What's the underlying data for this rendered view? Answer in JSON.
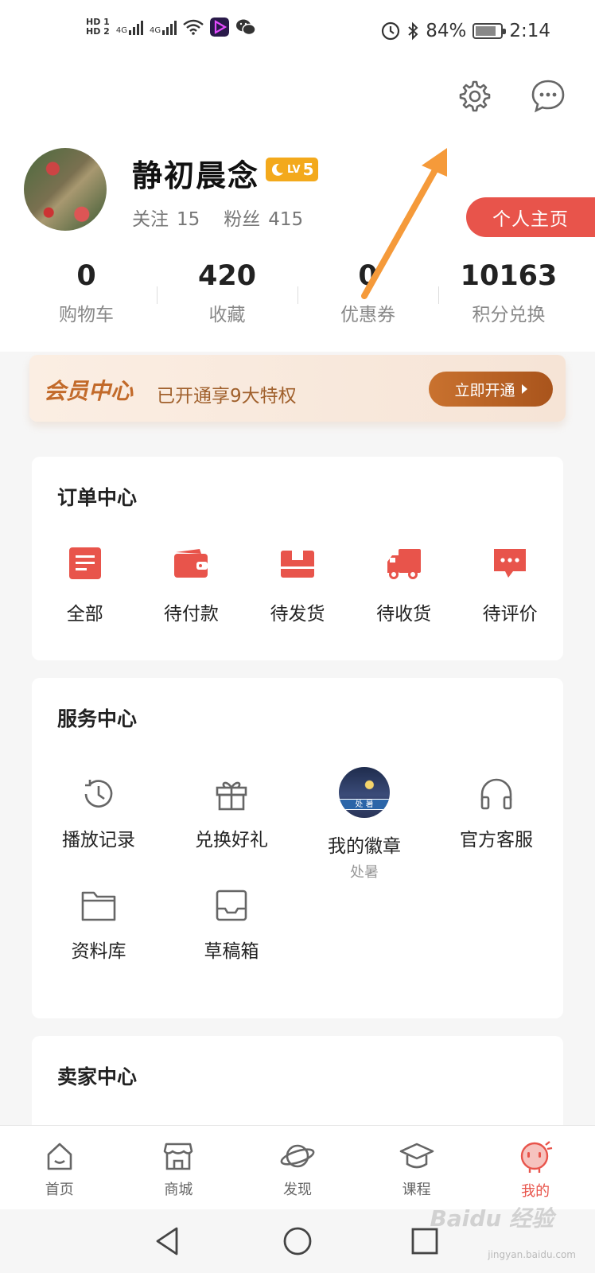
{
  "status_bar": {
    "hd1": "HD 1",
    "hd2": "HD 2",
    "net1": "4G",
    "net2": "4G",
    "battery_percent": "84%",
    "battery_level": 0.84,
    "time": "2:14"
  },
  "profile": {
    "username": "静初晨念",
    "level_prefix": "LV",
    "level_num": "5",
    "follow_label": "关注",
    "follow_count": "15",
    "fans_label": "粉丝",
    "fans_count": "415",
    "home_button": "个人主页"
  },
  "stats": [
    {
      "value": "0",
      "label": "购物车"
    },
    {
      "value": "420",
      "label": "收藏"
    },
    {
      "value": "0",
      "label": "优惠券"
    },
    {
      "value": "10163",
      "label": "积分兑换"
    }
  ],
  "vip": {
    "title": "会员中心",
    "subtitle": "已开通享9大特权",
    "button": "立即开通"
  },
  "orders": {
    "title": "订单中心",
    "items": [
      {
        "label": "全部",
        "icon": "list-icon"
      },
      {
        "label": "待付款",
        "icon": "wallet-icon"
      },
      {
        "label": "待发货",
        "icon": "box-icon"
      },
      {
        "label": "待收货",
        "icon": "truck-icon"
      },
      {
        "label": "待评价",
        "icon": "comment-icon"
      }
    ]
  },
  "services": {
    "title": "服务中心",
    "items": [
      {
        "label": "播放记录",
        "icon": "history-clock-icon"
      },
      {
        "label": "兑换好礼",
        "icon": "gift-icon"
      },
      {
        "label": "我的徽章",
        "sub": "处暑",
        "badge_text": "处 暑",
        "icon": "badge-icon"
      },
      {
        "label": "官方客服",
        "icon": "headset-icon"
      },
      {
        "label": "资料库",
        "icon": "folder-icon"
      },
      {
        "label": "草稿箱",
        "icon": "inbox-icon"
      }
    ]
  },
  "seller": {
    "title": "卖家中心"
  },
  "tabbar": {
    "items": [
      {
        "label": "首页",
        "icon": "home-icon"
      },
      {
        "label": "商城",
        "icon": "store-icon"
      },
      {
        "label": "发现",
        "icon": "planet-icon"
      },
      {
        "label": "课程",
        "icon": "graduation-cap-icon"
      },
      {
        "label": "我的",
        "icon": "mascot-icon",
        "active": true
      }
    ]
  },
  "watermark": {
    "text": "Baidu 经验",
    "sub": "jingyan.baidu.com"
  },
  "colors": {
    "accent": "#e8544b",
    "vip_brown": "#c26a2a",
    "arrow": "#f59a3a"
  }
}
